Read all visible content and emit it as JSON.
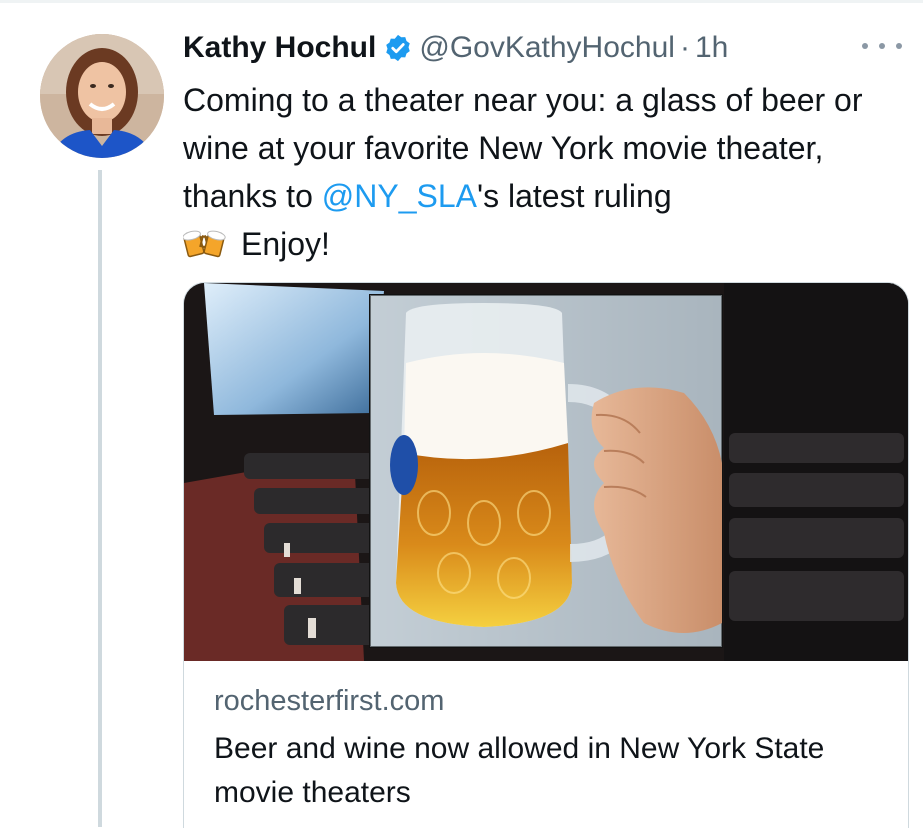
{
  "author": {
    "name": "Kathy Hochul",
    "handle": "@GovKathyHochul",
    "separator": "·",
    "time": "1h"
  },
  "tweet": {
    "text_part1": "Coming to a theater near you: a glass of beer or wine at your favorite New York movie theater, thanks to ",
    "mention": "@NY_SLA",
    "text_part2": "'s latest ruling",
    "emoji_icon": "beer-mugs-icon",
    "text_part3": "Enjoy!"
  },
  "card": {
    "domain": "rochesterfirst.com",
    "title": "Beer and wine now allowed in New York State movie theaters"
  },
  "colors": {
    "accent": "#1d9bf0",
    "text": "#0f1419",
    "secondary_text": "#536471",
    "border": "#cfd9de"
  }
}
